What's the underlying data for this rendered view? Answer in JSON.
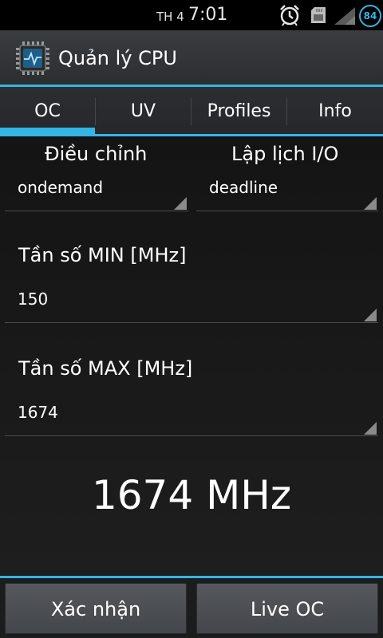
{
  "status_bar": {
    "day": "TH 4",
    "time": "7:01",
    "battery_level": "84",
    "icons": [
      "alarm-icon",
      "sd-card-icon",
      "signal-icon",
      "battery-icon"
    ]
  },
  "app": {
    "title": "Quản lý CPU",
    "icon": "cpu-chip-icon",
    "accent_color": "#33b5e5"
  },
  "tabs": [
    {
      "label": "OC",
      "selected": true
    },
    {
      "label": "UV",
      "selected": false
    },
    {
      "label": "Profiles",
      "selected": false
    },
    {
      "label": "Info",
      "selected": false
    }
  ],
  "governor": {
    "label": "Điều chỉnh",
    "value": "ondemand"
  },
  "io_scheduler": {
    "label": "Lập lịch I/O",
    "value": "deadline"
  },
  "min_freq": {
    "label": "Tần số MIN [MHz]",
    "value": "150"
  },
  "max_freq": {
    "label": "Tần số MAX [MHz]",
    "value": "1674"
  },
  "current_freq": "1674 MHz",
  "buttons": {
    "confirm": "Xác nhận",
    "live_oc": "Live OC"
  }
}
